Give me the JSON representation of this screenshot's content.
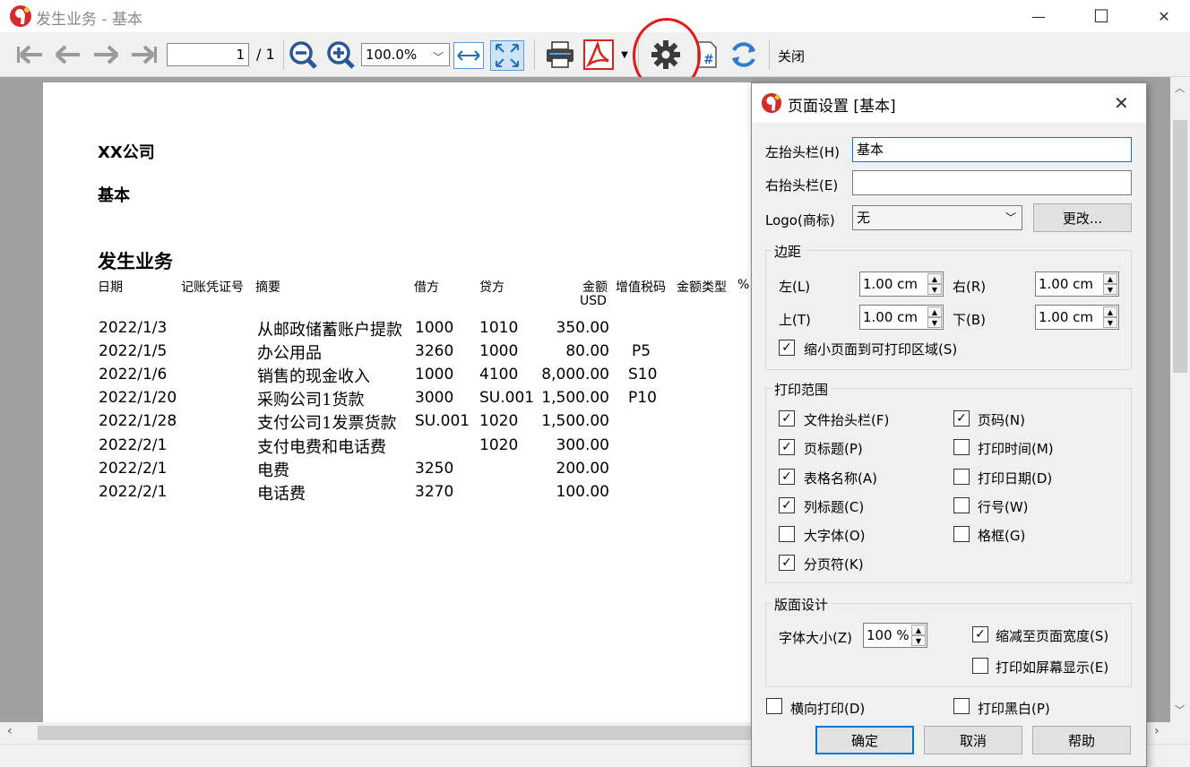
{
  "window": {
    "title": "发生业务 - 基本",
    "minimize": "—",
    "maximize": "☐",
    "close": "✕"
  },
  "toolbar": {
    "page_current": "1",
    "page_total": "/ 1",
    "zoom": "100.0%",
    "close_label": "关闭"
  },
  "report": {
    "company": "XX公司",
    "subtitle": "基本",
    "title": "发生业务",
    "headers": {
      "date": "日期",
      "voucher": "记账凭证号",
      "summary": "摘要",
      "debit": "借方",
      "credit": "贷方",
      "amount": "金额",
      "amount_unit": "USD",
      "vat_code": "增值税码",
      "amount_type": "金额类型",
      "percent": "%"
    },
    "rows": [
      {
        "date": "2022/1/3",
        "summary": "从邮政储蓄账户提款",
        "debit": "1000",
        "credit": "1010",
        "amount": "350.00",
        "vat": ""
      },
      {
        "date": "2022/1/5",
        "summary": "办公用品",
        "debit": "3260",
        "credit": "1000",
        "amount": "80.00",
        "vat": "P5"
      },
      {
        "date": "2022/1/6",
        "summary": "销售的现金收入",
        "debit": "1000",
        "credit": "4100",
        "amount": "8,000.00",
        "vat": "S10"
      },
      {
        "date": "2022/1/20",
        "summary": "采购公司1货款",
        "debit": "3000",
        "credit": "SU.001",
        "amount": "1,500.00",
        "vat": "P10"
      },
      {
        "date": "2022/1/28",
        "summary": "支付公司1发票货款",
        "debit": "SU.001",
        "credit": "1020",
        "amount": "1,500.00",
        "vat": ""
      },
      {
        "date": "2022/2/1",
        "summary": "支付电费和电话费",
        "debit": "",
        "credit": "1020",
        "amount": "300.00",
        "vat": ""
      },
      {
        "date": "2022/2/1",
        "summary": "电费",
        "debit": "3250",
        "credit": "",
        "amount": "200.00",
        "vat": ""
      },
      {
        "date": "2022/2/1",
        "summary": "电话费",
        "debit": "3270",
        "credit": "",
        "amount": "100.00",
        "vat": ""
      }
    ]
  },
  "dialog": {
    "title": "页面设置 [基本]",
    "left_header_label": "左抬头栏(H)",
    "left_header_value": "基本",
    "right_header_label": "右抬头栏(E)",
    "right_header_value": "",
    "logo_label": "Logo(商标)",
    "logo_value": "无",
    "change_button": "更改...",
    "margins": {
      "title": "边距",
      "left_label": "左(L)",
      "left_value": "1.00 cm",
      "right_label": "右(R)",
      "right_value": "1.00 cm",
      "top_label": "上(T)",
      "top_value": "1.00 cm",
      "bottom_label": "下(B)",
      "bottom_value": "1.00 cm",
      "shrink_label": "缩小页面到可打印区域(S)",
      "shrink_checked": "✓"
    },
    "print_range": {
      "title": "打印范围",
      "file_header": "文件抬头栏(F)",
      "page_number": "页码(N)",
      "page_title": "页标题(P)",
      "print_time": "打印时间(M)",
      "table_name": "表格名称(A)",
      "print_date": "打印日期(D)",
      "column_title": "列标题(C)",
      "row_number": "行号(W)",
      "large_font": "大字体(O)",
      "grid": "格框(G)",
      "page_break": "分页符(K)",
      "check_mark": "✓"
    },
    "layout": {
      "title": "版面设计",
      "font_size_label": "字体大小(Z)",
      "font_size_value": "100 %",
      "fit_width": "缩减至页面宽度(S)",
      "print_as_screen": "打印如屏幕显示(E)"
    },
    "landscape": "横向打印(D)",
    "black_white": "打印黑白(P)",
    "ok": "确定",
    "cancel": "取消",
    "help": "帮助"
  }
}
